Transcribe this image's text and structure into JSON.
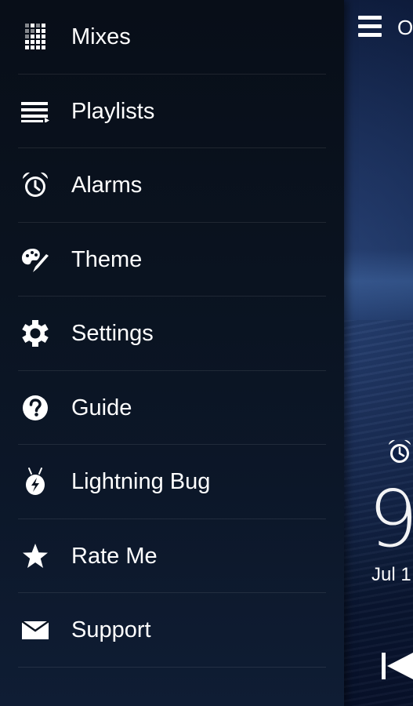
{
  "drawer": {
    "items": [
      {
        "label": "Mixes",
        "icon": "mixes-grid-icon"
      },
      {
        "label": "Playlists",
        "icon": "playlist-icon"
      },
      {
        "label": "Alarms",
        "icon": "alarm-clock-icon"
      },
      {
        "label": "Theme",
        "icon": "palette-icon"
      },
      {
        "label": "Settings",
        "icon": "gear-icon"
      },
      {
        "label": "Guide",
        "icon": "question-icon"
      },
      {
        "label": "Lightning Bug",
        "icon": "lightning-bug-icon"
      },
      {
        "label": "Rate Me",
        "icon": "star-icon"
      },
      {
        "label": "Support",
        "icon": "envelope-icon"
      }
    ]
  },
  "background_app": {
    "title": "O",
    "time": "9",
    "date": "Jul 1"
  },
  "colors": {
    "drawer_bg": "#0a1320",
    "text": "#ffffff",
    "divider": "rgba(255,255,255,0.09)"
  }
}
